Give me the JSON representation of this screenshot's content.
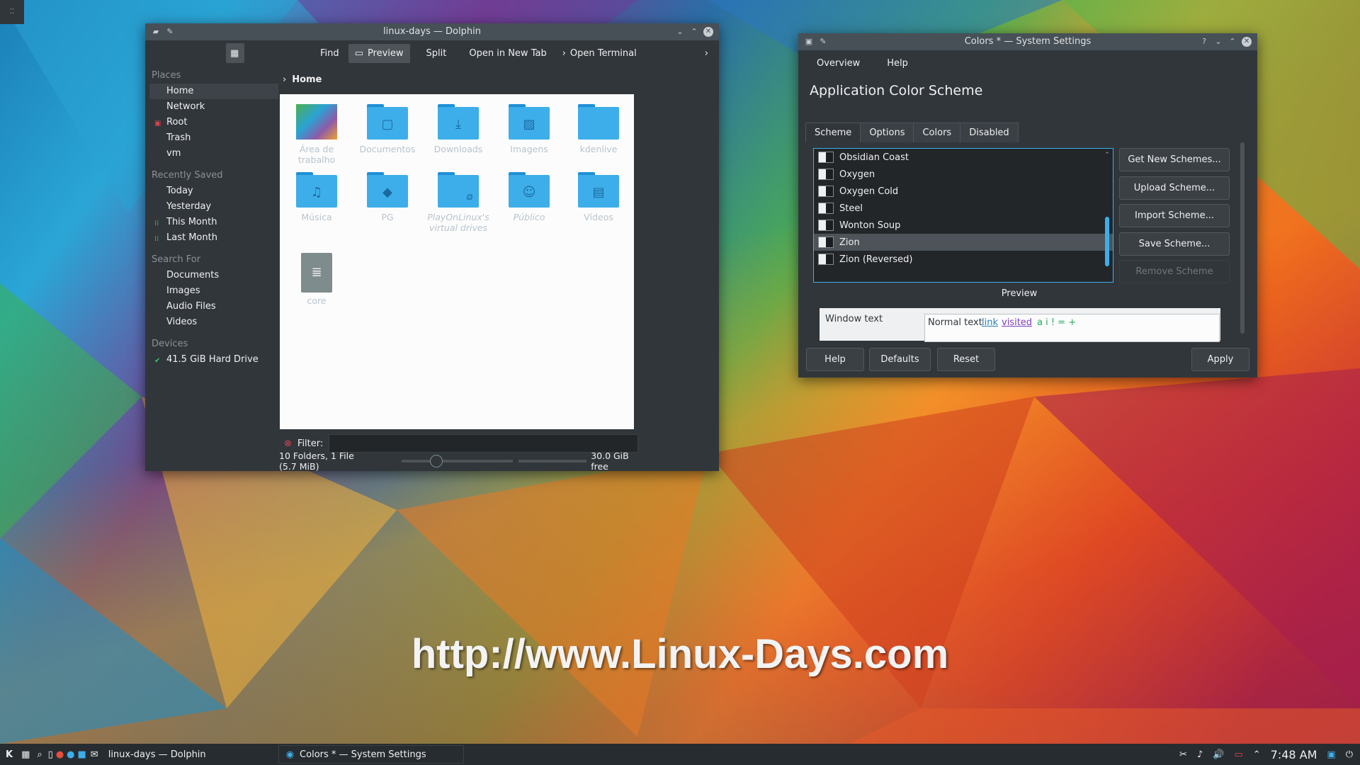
{
  "dolphin": {
    "title": "linux-days — Dolphin",
    "toolbar": [
      "Find",
      "Preview",
      "Split",
      "Open in New Tab",
      "Open Terminal"
    ],
    "places_heading": "Places",
    "places": [
      "Home",
      "Network",
      "Root",
      "Trash",
      "vm"
    ],
    "recent_heading": "Recently Saved",
    "recent": [
      "Today",
      "Yesterday",
      "This Month",
      "Last Month"
    ],
    "search_heading": "Search For",
    "search": [
      "Documents",
      "Images",
      "Audio Files",
      "Videos"
    ],
    "devices_heading": "Devices",
    "devices": [
      "41.5 GiB Hard Drive"
    ],
    "breadcrumb": "Home",
    "files": [
      "Área de trabalho",
      "Documentos",
      "Downloads",
      "Imagens",
      "kdenlive",
      "Música",
      "PG",
      "PlayOnLinux's virtual drives",
      "Público",
      "Vídeos",
      "core"
    ],
    "filter_label": "Filter:",
    "status": "10 Folders, 1 File (5.7 MiB)",
    "free": "30.0 GiB free"
  },
  "settings": {
    "title": "Colors * — System Settings",
    "nav": [
      "Overview",
      "Help"
    ],
    "heading": "Application Color Scheme",
    "tabs": [
      "Scheme",
      "Options",
      "Colors",
      "Disabled"
    ],
    "schemes": [
      "Obsidian Coast",
      "Oxygen",
      "Oxygen Cold",
      "Steel",
      "Wonton Soup",
      "Zion",
      "Zion (Reversed)"
    ],
    "selected_scheme": "Zion",
    "side_buttons": [
      "Get New Schemes...",
      "Upload Scheme...",
      "Import Scheme...",
      "Save Scheme...",
      "Remove Scheme"
    ],
    "preview_label": "Preview",
    "preview_window_text": "Window text",
    "preview_normal": "Normal text",
    "preview_link": "link",
    "preview_visited": "visited",
    "preview_symbols": "a i ! = +",
    "bottom_buttons": [
      "Help",
      "Defaults",
      "Reset",
      "Apply"
    ]
  },
  "taskbar": {
    "tasks": [
      "linux-days — Dolphin",
      "Colors * — System Settings"
    ],
    "clock": "7:48 AM"
  },
  "watermark": "http://www.Linux-Days.com"
}
